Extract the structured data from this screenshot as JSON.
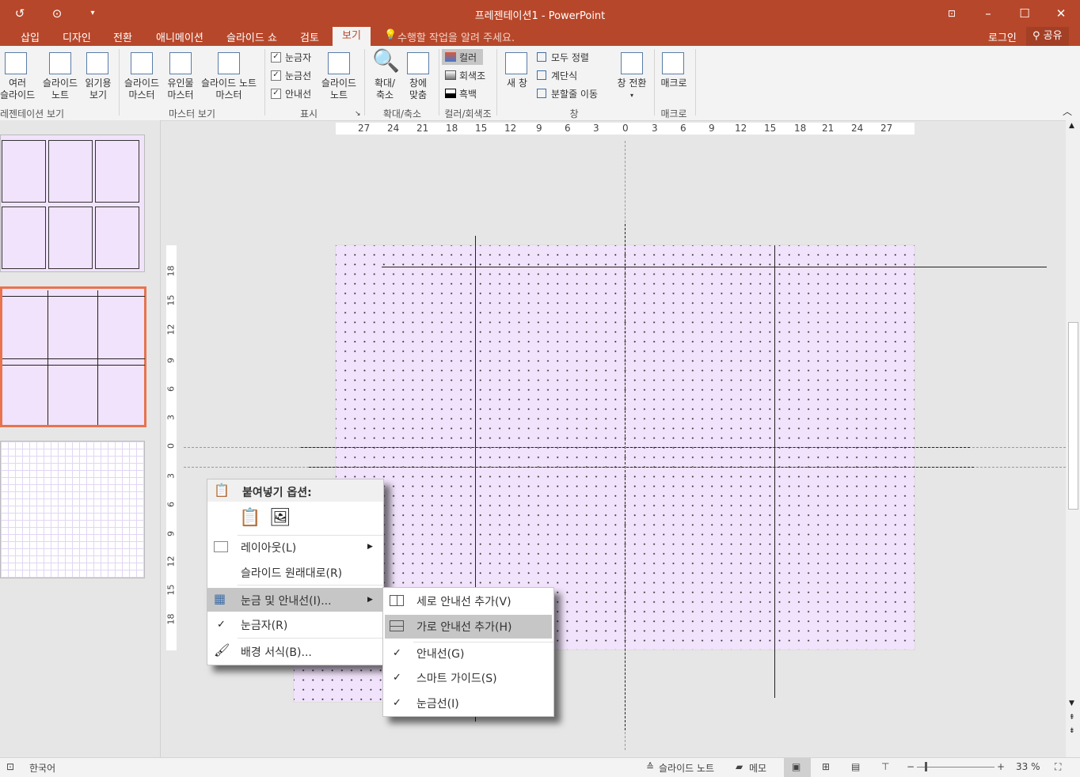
{
  "titlebar": {
    "title": "프레젠테이션1 - PowerPoint",
    "icons": [
      "undo-icon",
      "present-icon",
      "customize-icon",
      "ribbon-display-icon",
      "minimize-icon",
      "maximize-icon",
      "close-icon"
    ]
  },
  "tabs": [
    "삽입",
    "디자인",
    "전환",
    "애니메이션",
    "슬라이드 쇼",
    "검토",
    "보기"
  ],
  "active_tab": "보기",
  "tell_me": "수행할 작업을 알려 주세요.",
  "signin": "로그인",
  "share": "공유",
  "ribbon": {
    "presentation_views": {
      "group": "레젠테이션 보기",
      "items": [
        {
          "l1": "여러",
          "l2": "슬라이드"
        },
        {
          "l1": "슬라이드",
          "l2": "노트"
        },
        {
          "l1": "읽기용",
          "l2": "보기"
        }
      ]
    },
    "master_views": {
      "group": "마스터 보기",
      "items": [
        {
          "l1": "슬라이드",
          "l2": "마스터"
        },
        {
          "l1": "유인물",
          "l2": "마스터"
        },
        {
          "l1": "슬라이드 노트",
          "l2": "마스터"
        }
      ]
    },
    "show": {
      "group": "표시",
      "checks": [
        "눈금자",
        "눈금선",
        "안내선"
      ],
      "notes": {
        "l1": "슬라이드",
        "l2": "노트"
      }
    },
    "zoom": {
      "group": "확대/축소",
      "zoom": {
        "l1": "확대/",
        "l2": "축소"
      },
      "fit": {
        "l1": "창에",
        "l2": "맞춤"
      }
    },
    "color": {
      "group": "컬러/회색조",
      "items": [
        "컬러",
        "회색조",
        "흑백"
      ]
    },
    "window": {
      "group": "창",
      "new_window": "새 창",
      "items": [
        "모두 정렬",
        "계단식",
        "분할줄 이동"
      ],
      "switch": "창 전환"
    },
    "macro": {
      "group": "매크로",
      "label": "매크로"
    }
  },
  "ruler_h": [
    "27",
    "24",
    "21",
    "18",
    "15",
    "12",
    "9",
    "6",
    "3",
    "0",
    "3",
    "6",
    "9",
    "12",
    "15",
    "18",
    "21",
    "24",
    "27"
  ],
  "ruler_v": [
    "18",
    "15",
    "12",
    "9",
    "6",
    "3",
    "0",
    "3",
    "6",
    "9",
    "12",
    "15",
    "18"
  ],
  "context_menu": {
    "paste_options": "붙여넣기 옵션:",
    "layout": "레이아웃(L)",
    "reset": "슬라이드 원래대로(R)",
    "grid_guides": "눈금 및 안내선(I)...",
    "ruler": "눈금자(R)",
    "format_bg": "배경 서식(B)..."
  },
  "submenu": {
    "add_vertical": "세로 안내선 추가(V)",
    "add_horizontal": "가로 안내선 추가(H)",
    "guides": "안내선(G)",
    "smart_guides": "스마트 가이드(S)",
    "gridlines": "눈금선(I)"
  },
  "statusbar": {
    "language": "한국어",
    "notes": "슬라이드 노트",
    "comments": "메모",
    "zoom": "33 %"
  },
  "colors": {
    "accent": "#b7472a",
    "slide_bg": "#f1e3fb",
    "selected_border": "#e8734d"
  }
}
